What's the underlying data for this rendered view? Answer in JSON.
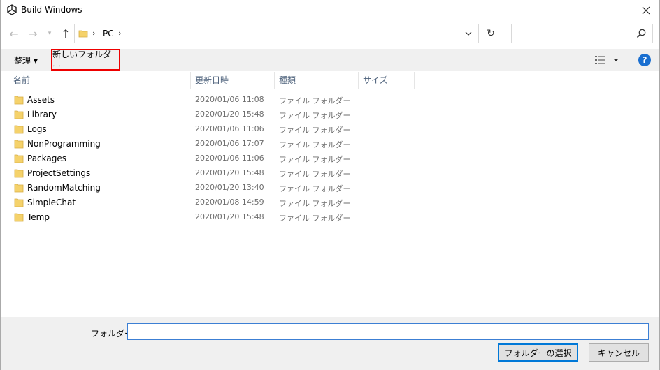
{
  "window": {
    "title": "Build Windows"
  },
  "nav": {
    "back_glyph": "←",
    "forward_glyph": "→",
    "recent_glyph": "▾",
    "up_glyph": "↑"
  },
  "address": {
    "sep1": "›",
    "location": "PC",
    "sep2": "›",
    "dropdown_glyph": "⌄",
    "refresh_glyph": "↻"
  },
  "search": {
    "placeholder": ""
  },
  "toolbar": {
    "organize_label": "整理 ▾",
    "new_folder_label": "新しいフォルダー",
    "help_label": "?"
  },
  "columns": {
    "name": "名前",
    "date": "更新日時",
    "type": "種類",
    "size": "サイズ"
  },
  "files": [
    {
      "name": "Assets",
      "date": "2020/01/06 11:08",
      "type": "ファイル フォルダー"
    },
    {
      "name": "Library",
      "date": "2020/01/20 15:48",
      "type": "ファイル フォルダー"
    },
    {
      "name": "Logs",
      "date": "2020/01/06 11:06",
      "type": "ファイル フォルダー"
    },
    {
      "name": "NonProgramming",
      "date": "2020/01/06 17:07",
      "type": "ファイル フォルダー"
    },
    {
      "name": "Packages",
      "date": "2020/01/06 11:06",
      "type": "ファイル フォルダー"
    },
    {
      "name": "ProjectSettings",
      "date": "2020/01/20 15:48",
      "type": "ファイル フォルダー"
    },
    {
      "name": "RandomMatching",
      "date": "2020/01/20 13:40",
      "type": "ファイル フォルダー"
    },
    {
      "name": "SimpleChat",
      "date": "2020/01/08 14:59",
      "type": "ファイル フォルダー"
    },
    {
      "name": "Temp",
      "date": "2020/01/20 15:48",
      "type": "ファイル フォルダー"
    }
  ],
  "footer": {
    "folder_label": "フォルダー:",
    "folder_value": "",
    "select_label": "フォルダーの選択",
    "cancel_label": "キャンセル"
  },
  "colors": {
    "accent": "#0078d7",
    "highlight_box": "#e00000",
    "folder_yellow": "#f5d26b",
    "help_blue": "#1a6fd0"
  }
}
